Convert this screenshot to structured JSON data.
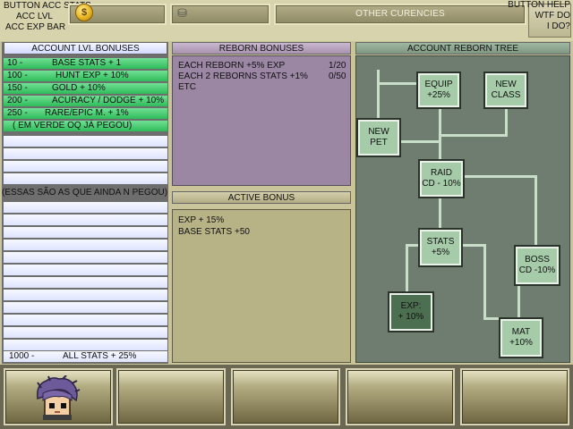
{
  "top": {
    "left_labels": [
      "BUTTON ACC STATS",
      "ACC LVL",
      "ACC EXP BAR"
    ],
    "other_currencies": "OTHER CURENCIES",
    "help_labels": [
      "BUTTON HELP",
      "WTF DO",
      "I DO?"
    ]
  },
  "account_lvl": {
    "title": "ACCOUNT LVL BONUSES",
    "rows": [
      {
        "lvl": "10 -",
        "bonus": "BASE STATS + 1",
        "style": "green"
      },
      {
        "lvl": "100 -",
        "bonus": "HUNT EXP + 10%",
        "style": "green"
      },
      {
        "lvl": "150 -",
        "bonus": "GOLD + 10%",
        "style": "green"
      },
      {
        "lvl": "200 -",
        "bonus": "ACURACY / DODGE + 10%",
        "style": "green"
      },
      {
        "lvl": "250 -",
        "bonus": "RARE/EPIC M. + 1%",
        "style": "green"
      }
    ],
    "note_green": "( EM VERDE OQ JÁ PEGOU)",
    "note_light": "(ESSAS SÃO AS QUE AINDA N PEGOU)",
    "last_row": {
      "lvl": "1000 -",
      "bonus": "ALL STATS + 25%"
    }
  },
  "reborn": {
    "title": "REBORN BONUSES",
    "rows": [
      {
        "text": "EACH REBORN  +5% EXP",
        "value": "1/20"
      },
      {
        "text": "EACH 2 REBORNS  STATS +1%",
        "value": "0/50"
      },
      {
        "text": "ETC",
        "value": ""
      }
    ]
  },
  "active": {
    "title": "ACTIVE BONUS",
    "lines": [
      "EXP + 15%",
      "BASE STATS +50"
    ]
  },
  "tree": {
    "title": "ACCOUNT REBORN TREE",
    "nodes": {
      "equip": [
        "EQUIP",
        "+25%"
      ],
      "new_class": [
        "NEW",
        "CLASS"
      ],
      "new_pet": [
        "NEW",
        "PET"
      ],
      "raid": [
        "RAID",
        "CD - 10%"
      ],
      "stats": [
        "STATS",
        "+5%"
      ],
      "boss": [
        "BOSS",
        "CD -10%"
      ],
      "exp": [
        "EXP:",
        "+ 10%"
      ],
      "mat": [
        "MAT",
        "+10%"
      ]
    }
  },
  "colors": {
    "green_row": "#2ebb5a",
    "reborn_panel": "#9b86a4",
    "tree_panel": "#6f7d70",
    "node": "#a6cba9"
  }
}
